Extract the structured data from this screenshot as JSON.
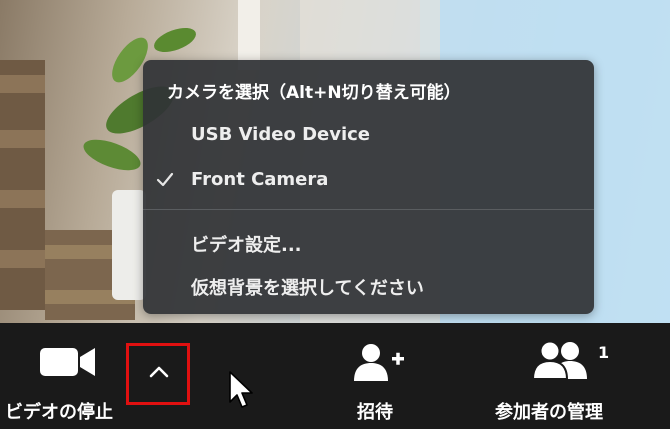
{
  "camera_menu": {
    "header": "カメラを選択（Alt+N切り替え可能）",
    "devices": [
      {
        "label": "USB Video Device",
        "selected": false
      },
      {
        "label": "Front Camera",
        "selected": true
      }
    ],
    "actions": [
      {
        "label": "ビデオ設定..."
      },
      {
        "label": "仮想背景を選択してください"
      }
    ],
    "check_icon": "checkmark-icon"
  },
  "toolbar": {
    "stop_video_label": "ビデオの停止",
    "video_icon": "video-camera-icon",
    "caret_icon": "chevron-up-icon",
    "invite_label": "招待",
    "invite_icon": "add-user-icon",
    "participants_label": "参加者の管理",
    "participants_icon": "participants-icon",
    "participants_count": "1",
    "highlight_color": "#e01010"
  }
}
